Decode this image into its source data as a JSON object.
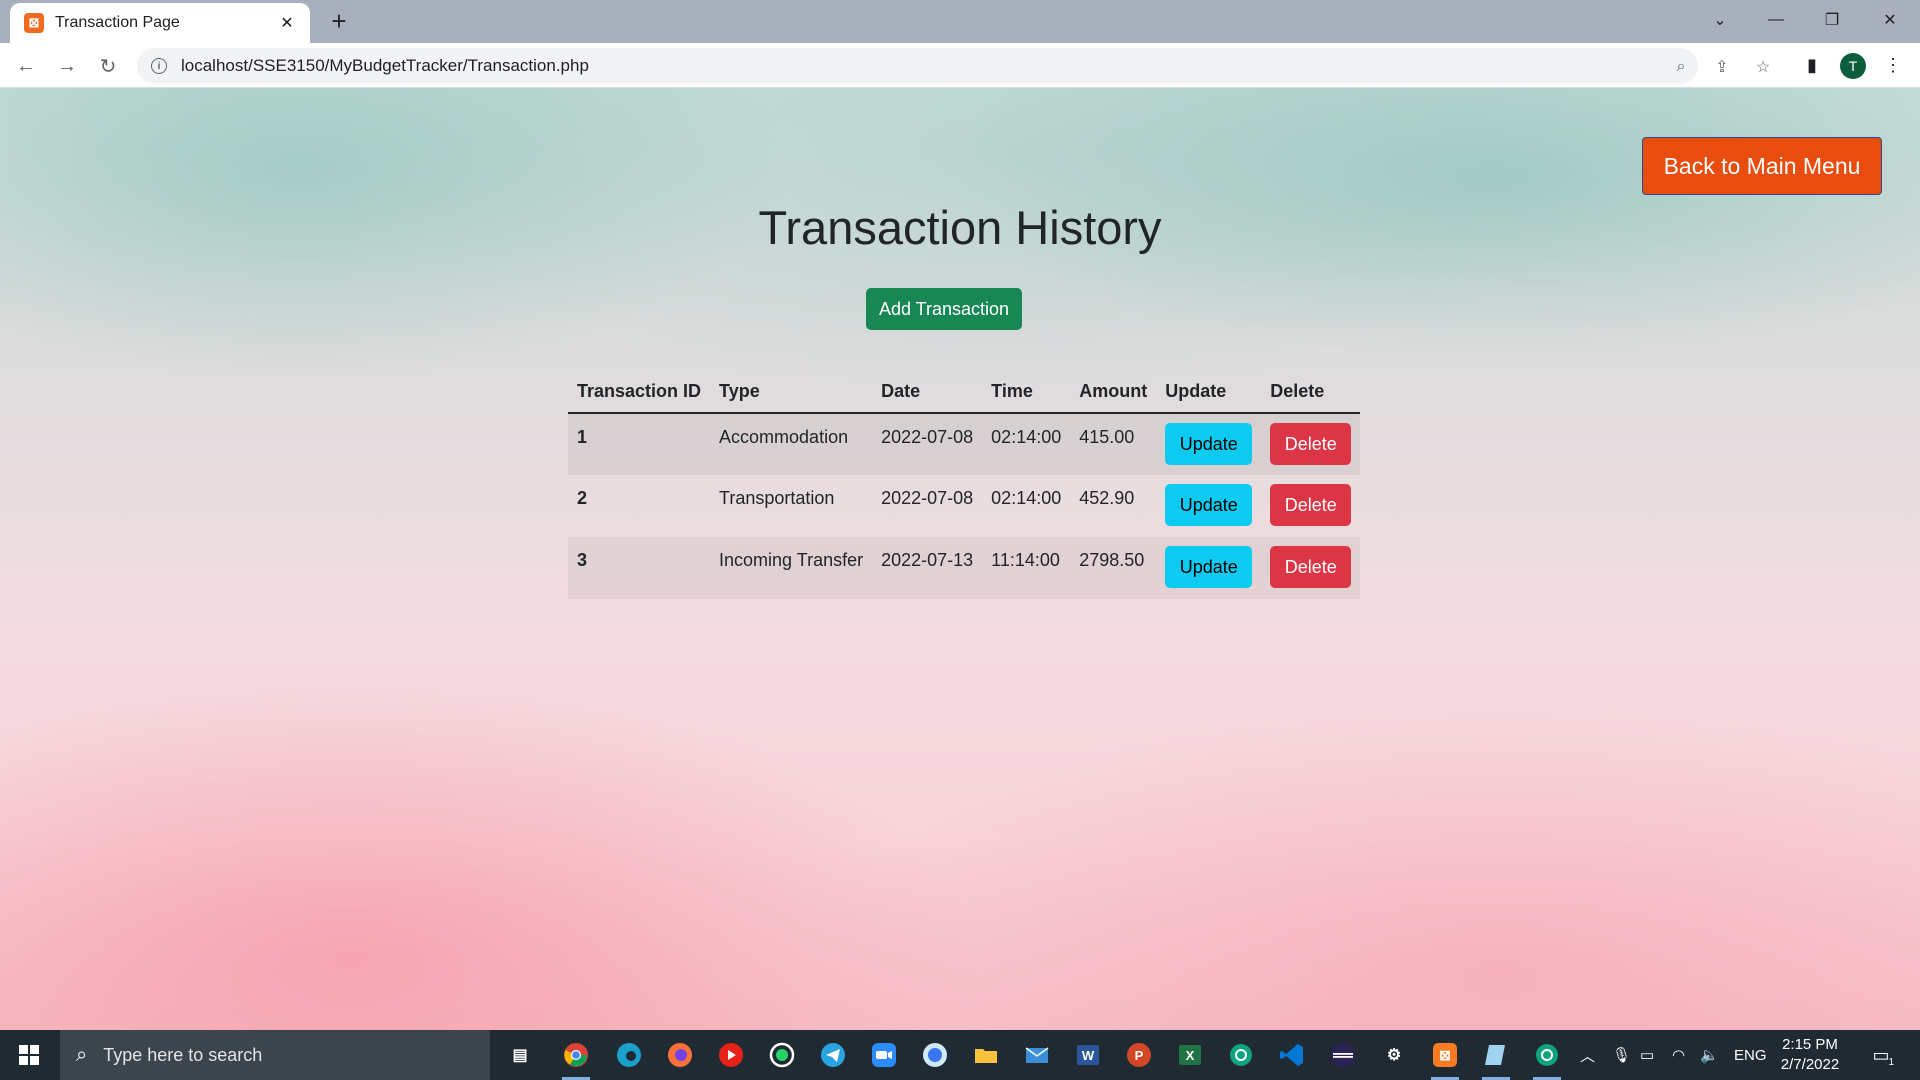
{
  "browser": {
    "tab_title": "Transaction Page",
    "tab_favicon": "xampp-icon",
    "url": "localhost/SSE3150/MyBudgetTracker/Transaction.php",
    "profile_initial": "T"
  },
  "page": {
    "back_button_label": "Back to Main Menu",
    "title": "Transaction History",
    "add_button_label": "Add Transaction",
    "table": {
      "headers": [
        "Transaction ID",
        "Type",
        "Date",
        "Time",
        "Amount",
        "Update",
        "Delete"
      ],
      "rows": [
        {
          "id": "1",
          "type": "Accommodation",
          "date": "2022-07-08",
          "time": "02:14:00",
          "amount": "415.00",
          "update": "Update",
          "delete": "Delete"
        },
        {
          "id": "2",
          "type": "Transportation",
          "date": "2022-07-08",
          "time": "02:14:00",
          "amount": "452.90",
          "update": "Update",
          "delete": "Delete"
        },
        {
          "id": "3",
          "type": "Incoming Transfer",
          "date": "2022-07-13",
          "time": "11:14:00",
          "amount": "2798.50",
          "update": "Update",
          "delete": "Delete"
        }
      ]
    },
    "colors": {
      "back_button": "#e84c0e",
      "add_button": "#198754",
      "update_button": "#0dcaf0",
      "delete_button": "#dc3545"
    }
  },
  "taskbar": {
    "search_placeholder": "Type here to search",
    "tray_language": "ENG",
    "time": "2:15 PM",
    "date": "2/7/2022",
    "notification_count": "1"
  }
}
